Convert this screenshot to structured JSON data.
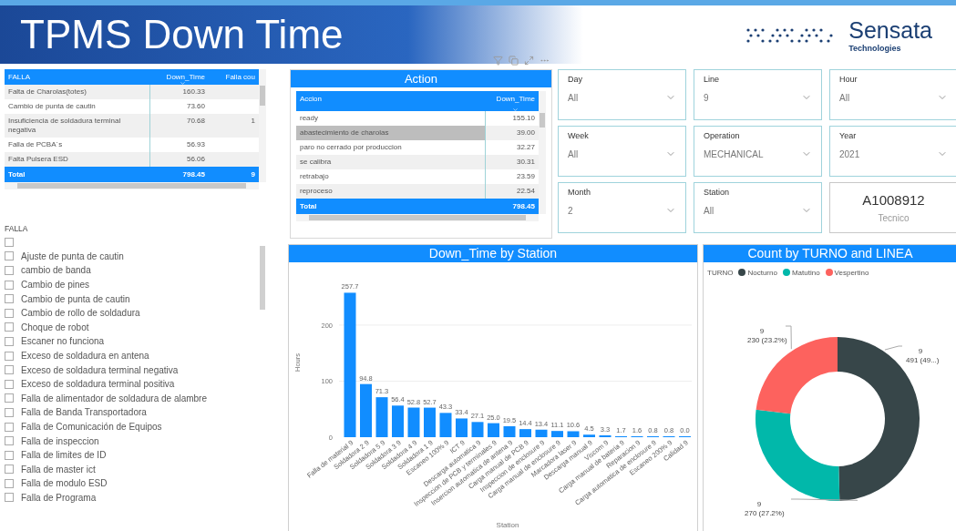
{
  "header": {
    "title": "TPMS Down Time",
    "brand": "Sensata",
    "brand_sub": "Technologies"
  },
  "falla_table": {
    "columns": [
      "FALLA",
      "Down_Time",
      "Falla cou"
    ],
    "rows": [
      {
        "falla": "Falta de Charolas(totes)",
        "down_time": "160.33"
      },
      {
        "falla": "Cambio de punta de cautin",
        "down_time": "73.60"
      },
      {
        "falla": "Insuficiencia de soldadura terminal negativa",
        "down_time": "70.68",
        "column_3": "1"
      },
      {
        "falla": "Falla de PCBA´s",
        "down_time": "56.93"
      },
      {
        "falla": "Falta Pulsera ESD",
        "down_time": "56.06"
      }
    ],
    "total": {
      "label": "Total",
      "down_time": "798.45",
      "column_3": "9"
    }
  },
  "action_table": {
    "title": "Action",
    "columns": [
      "Accion",
      "Down_Time"
    ],
    "rows": [
      {
        "accion": "ready",
        "down_time": "155.10",
        "selected": false
      },
      {
        "accion": "abastecimiento de charolas",
        "down_time": "39.00",
        "selected": true
      },
      {
        "accion": "paro no cerrado por produccion",
        "down_time": "32.27",
        "selected": false
      },
      {
        "accion": "se calibra",
        "down_time": "30.31",
        "selected": false
      },
      {
        "accion": "retrabajo",
        "down_time": "23.59",
        "selected": false
      },
      {
        "accion": "reproceso",
        "down_time": "22.54",
        "selected": false
      }
    ],
    "total": {
      "label": "Total",
      "down_time": "798.45"
    }
  },
  "slicers": [
    {
      "label": "Day",
      "value": "All"
    },
    {
      "label": "Line",
      "value": "9"
    },
    {
      "label": "Hour",
      "value": "All"
    },
    {
      "label": "Week",
      "value": "All"
    },
    {
      "label": "Operation",
      "value": "MECHANICAL"
    },
    {
      "label": "Year",
      "value": "2021"
    },
    {
      "label": "Month",
      "value": "2"
    },
    {
      "label": "Station",
      "value": "All"
    }
  ],
  "card": {
    "value": "A1008912",
    "label": "Tecnico"
  },
  "falla_slicer": {
    "title": "FALLA",
    "items": [
      {
        "checked": false
      },
      {
        "label": "Ajuste de punta de cautin",
        "checked": false
      },
      {
        "label": "cambio de banda",
        "checked": false
      },
      {
        "label": "Cambio de pines",
        "checked": false
      },
      {
        "label": "Cambio de punta de cautin",
        "checked": false
      },
      {
        "label": "Cambio de rollo de soldadura",
        "checked": false
      },
      {
        "label": "Choque de robot",
        "checked": false
      },
      {
        "label": "Escaner no funciona",
        "checked": false
      },
      {
        "label": "Exceso de soldadura en antena",
        "checked": false
      },
      {
        "label": "Exceso de soldadura terminal negativa",
        "checked": false
      },
      {
        "label": "Exceso de soldadura terminal positiva",
        "checked": false
      },
      {
        "label": "Falla de alimentador de soldadura de alambre",
        "checked": false
      },
      {
        "label": "Falla de Banda Transportadora",
        "checked": false
      },
      {
        "label": "Falla de Comunicación de Equipos",
        "checked": false
      },
      {
        "label": "Falla de inspeccion",
        "checked": false
      },
      {
        "label": "Falla de limites de ID",
        "checked": false
      },
      {
        "label": "Falla de master ict",
        "checked": false
      },
      {
        "label": "Falla de modulo ESD",
        "checked": false
      },
      {
        "label": "Falla de Programa",
        "checked": false
      }
    ]
  },
  "bar_chart": {
    "chart_data": {
      "type": "bar",
      "title": "Down_Time by Station",
      "xlabel": "Station",
      "ylabel": "Hours",
      "categories": [
        "Falla de material 9",
        "Soldadora 2 9",
        "Soldadora 5 9",
        "Soldadora 3 9",
        "Soldadora 4 9",
        "Soldadora 1 9",
        "Escaneo 100% 9",
        "ICT 9",
        "Descarga automatica 9",
        "Inspeccion de PCB y terminales 9",
        "Insercion automatica de antena 9",
        "Carga manual de PCB 9",
        "Inspeccion de enclosure 9",
        "Carga manual de enclosure 9",
        "Marcadora laser 9",
        "Descarga manual 9",
        "Viscom 9",
        "Carga manual de bateria 9",
        "Reparacion 9",
        "Carga automatica de enclosure 9",
        "Escaneo 200% 9",
        "Calidad 9"
      ],
      "series": [
        {
          "color": "#118dff",
          "values": [
            257.7,
            94.8,
            71.3,
            56.4,
            52.8,
            52.7,
            43.3,
            33.4,
            27.1,
            25.0,
            19.5,
            14.4,
            13.4,
            11.1,
            10.6,
            4.5,
            3.3,
            1.7,
            1.6,
            0.8,
            0.8,
            0.0
          ]
        }
      ],
      "value_labels": [
        "257.7",
        "94.8",
        "71.3",
        "56.4",
        "52.8",
        "52.7",
        "43.3",
        "33.4",
        "27.1",
        "25.0",
        "19.5",
        "14.4",
        "13.4",
        "11.1",
        "10.6",
        "4.5",
        "3.3",
        "1.7",
        "1.6",
        "0.8",
        "0.8",
        "0.0"
      ],
      "ylim": [
        0,
        260
      ],
      "yticks": [
        0,
        100,
        200
      ]
    }
  },
  "donut_chart": {
    "legend": {
      "title": "TURNO",
      "items": [
        {
          "color": "#374649"
        },
        {
          "color": "#01b8aa"
        },
        {
          "color": "#fd625e"
        }
      ]
    },
    "chart_data": {
      "type": "donut",
      "title": "Count by TURNO and LINEA",
      "categories": [
        "Nocturno",
        "Matutino",
        "Vespertino"
      ],
      "series": [
        {
          "values": [
            49.6,
            27.2,
            23.2
          ]
        }
      ],
      "value_labels": [
        "491 (49...)",
        "270 (27.2%)",
        "230 (23.2%)"
      ],
      "annotations": [
        "9",
        "9",
        "9"
      ]
    }
  }
}
